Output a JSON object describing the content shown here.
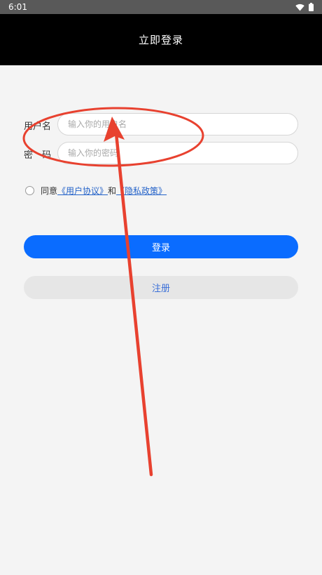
{
  "status_bar": {
    "time": "6:01",
    "icons": [
      "wifi-icon",
      "battery-icon"
    ]
  },
  "header": {
    "title": "立即登录"
  },
  "form": {
    "username_label": "用户名",
    "username_placeholder": "输入你的用户名",
    "password_label": "密　码",
    "password_placeholder": "输入你的密码"
  },
  "agreement": {
    "prefix": "同意",
    "user_agreement": "《用户协议》",
    "conjunction": "和",
    "privacy_policy": "《隐私政策》"
  },
  "buttons": {
    "login": "登录",
    "register": "注册"
  },
  "colors": {
    "primary": "#0a6cff",
    "header_bg": "#000000",
    "link": "#2563c9",
    "annotation": "#e8412f"
  }
}
